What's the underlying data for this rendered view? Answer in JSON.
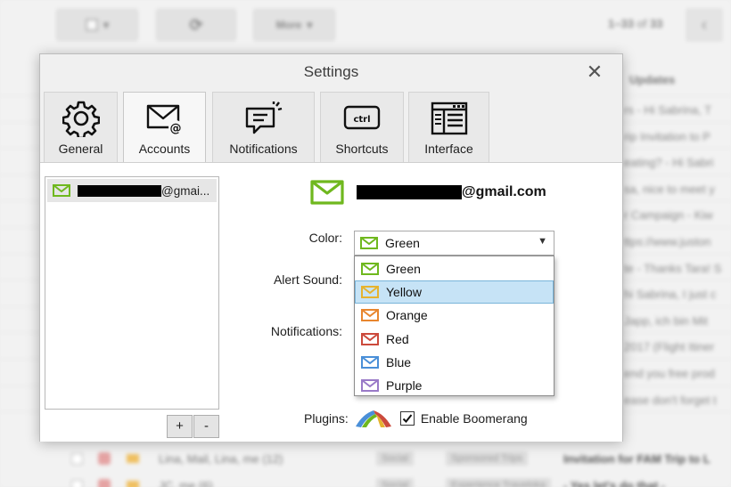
{
  "background": {
    "toolbar": {
      "more_label": "More",
      "count_prefix": "1–33",
      "count_of": "of",
      "count_total": "33",
      "prev_glyph": "‹"
    },
    "list_header": "Updates",
    "rows": [
      {
        "snippet": "rs - Hi Sabrina, T"
      },
      {
        "snippet": "rip Invitation to P"
      },
      {
        "snippet": "eating? - Hi Sabri"
      },
      {
        "snippet": "sa, nice to meet y"
      },
      {
        "snippet": "r Campaign - Kiw"
      },
      {
        "snippet": "ttps://www.juston"
      },
      {
        "snippet": "te - Thanks Tara! S"
      },
      {
        "snippet": "hi Sabrina, I just c"
      },
      {
        "snippet": "Japp, ich bin Mit"
      },
      {
        "snippet": "2017 (Flight Itiner"
      },
      {
        "snippet": "end you free prod"
      },
      {
        "snippet": "ease don't forget t"
      }
    ],
    "bottom_rows": [
      {
        "who": "Lina, Mail, Lina, me (12)",
        "label1": "Social",
        "label2": "Sponsored Trips",
        "subject": "Invitation for FAM Trip to L"
      },
      {
        "who": "JC, me (6)",
        "label1": "Social",
        "label2": "Experience Traveloka",
        "subject": "- Yes let's do that - "
      }
    ]
  },
  "dialog": {
    "title": "Settings",
    "close_glyph": "✕",
    "tabs": [
      {
        "label": "General",
        "icon": "gear-icon"
      },
      {
        "label": "Accounts",
        "icon": "mail-at-icon"
      },
      {
        "label": "Notifications",
        "icon": "notification-icon"
      },
      {
        "label": "Shortcuts",
        "icon": "keyboard-ctrl-icon"
      },
      {
        "label": "Interface",
        "icon": "window-icon"
      }
    ],
    "ctrl_text": "ctrl",
    "active_tab": "Accounts",
    "accounts": [
      {
        "label_suffix": "@gmai..."
      }
    ],
    "add_label": "+",
    "remove_label": "-",
    "account_email_suffix": "@gmail.com",
    "color_label": "Color:",
    "alert_sound_label": "Alert Sound:",
    "notifications_label": "Notifications:",
    "plugins_label": "Plugins:",
    "color_selected": "Green",
    "color_options": [
      {
        "label": "Green",
        "color": "#6fb81e"
      },
      {
        "label": "Yellow",
        "color": "#e6b32e"
      },
      {
        "label": "Orange",
        "color": "#e8862e"
      },
      {
        "label": "Red",
        "color": "#cc4a3c"
      },
      {
        "label": "Blue",
        "color": "#4a8fd8"
      },
      {
        "label": "Purple",
        "color": "#9a7ac8"
      }
    ],
    "highlighted_option": "Yellow",
    "boomerang_label": "Enable Boomerang",
    "boomerang_checked": true
  }
}
